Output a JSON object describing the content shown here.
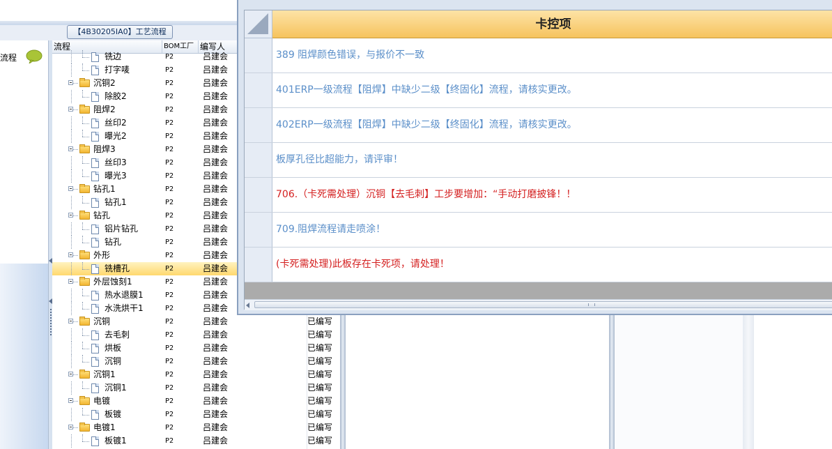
{
  "left_panel": {
    "title": "流程"
  },
  "process_tab": {
    "label": "【4B30205IA0】工艺流程"
  },
  "tree_headers": {
    "flow": "流程",
    "bom": "BOM工厂",
    "writer": "编写人"
  },
  "tree_rows": [
    {
      "name": "铣边",
      "level": 1,
      "bom": "P2",
      "writer": "吕建会"
    },
    {
      "name": "打字唛",
      "level": 1,
      "bom": "P2",
      "writer": "吕建会"
    },
    {
      "name": "沉铜2",
      "level": 0,
      "bom": "P2",
      "writer": "吕建会"
    },
    {
      "name": "除胶2",
      "level": 1,
      "bom": "P2",
      "writer": "吕建会"
    },
    {
      "name": "阻焊2",
      "level": 0,
      "bom": "P2",
      "writer": "吕建会"
    },
    {
      "name": "丝印2",
      "level": 1,
      "bom": "P2",
      "writer": "吕建会"
    },
    {
      "name": "曝光2",
      "level": 1,
      "bom": "P2",
      "writer": "吕建会"
    },
    {
      "name": "阻焊3",
      "level": 0,
      "bom": "P2",
      "writer": "吕建会"
    },
    {
      "name": "丝印3",
      "level": 1,
      "bom": "P2",
      "writer": "吕建会"
    },
    {
      "name": "曝光3",
      "level": 1,
      "bom": "P2",
      "writer": "吕建会"
    },
    {
      "name": "钻孔1",
      "level": 0,
      "bom": "P2",
      "writer": "吕建会"
    },
    {
      "name": "钻孔1",
      "level": 1,
      "bom": "P2",
      "writer": "吕建会"
    },
    {
      "name": "钻孔",
      "level": 0,
      "bom": "P2",
      "writer": "吕建会"
    },
    {
      "name": "铝片钻孔",
      "level": 1,
      "bom": "P2",
      "writer": "吕建会"
    },
    {
      "name": "钻孔",
      "level": 1,
      "bom": "P2",
      "writer": "吕建会"
    },
    {
      "name": "外形",
      "level": 0,
      "bom": "P2",
      "writer": "吕建会"
    },
    {
      "name": "铣槽孔",
      "level": 1,
      "bom": "P2",
      "writer": "吕建会",
      "selected": true
    },
    {
      "name": "外层蚀刻1",
      "level": 0,
      "bom": "P2",
      "writer": "吕建会"
    },
    {
      "name": "热水退膜1",
      "level": 1,
      "bom": "P2",
      "writer": "吕建会"
    },
    {
      "name": "水洗烘干1",
      "level": 1,
      "bom": "P2",
      "writer": "吕建会"
    },
    {
      "name": "沉铜",
      "level": 0,
      "bom": "P2",
      "writer": "吕建会"
    },
    {
      "name": "去毛刺",
      "level": 1,
      "bom": "P2",
      "writer": "吕建会"
    },
    {
      "name": "烘板",
      "level": 1,
      "bom": "P2",
      "writer": "吕建会"
    },
    {
      "name": "沉铜",
      "level": 1,
      "bom": "P2",
      "writer": "吕建会"
    },
    {
      "name": "沉铜1",
      "level": 0,
      "bom": "P2",
      "writer": "吕建会"
    },
    {
      "name": "沉铜1",
      "level": 1,
      "bom": "P2",
      "writer": "吕建会"
    },
    {
      "name": "电镀",
      "level": 0,
      "bom": "P2",
      "writer": "吕建会"
    },
    {
      "name": "板镀",
      "level": 1,
      "bom": "P2",
      "writer": "吕建会"
    },
    {
      "name": "电镀1",
      "level": 0,
      "bom": "P2",
      "writer": "吕建会"
    },
    {
      "name": "板镀1",
      "level": 1,
      "bom": "P2",
      "writer": "吕建会"
    }
  ],
  "status_values": [
    "已编写",
    "已编写",
    "已编写",
    "已编写",
    "已编写",
    "已编写",
    "已编写",
    "已编写",
    "已编写",
    "已编写"
  ],
  "dialog": {
    "header": "卡控项",
    "rows": [
      {
        "text": "389 阻焊颜色错误，与报价不一致",
        "color": "#5b8fc9"
      },
      {
        "text": "401ERP一级流程【阻焊】中缺少二级【终固化】流程，请核实更改。",
        "color": "#5b8fc9"
      },
      {
        "text": "402ERP一级流程【阻焊】中缺少二级【终固化】流程，请核实更改。",
        "color": "#5b8fc9"
      },
      {
        "text": "板厚孔径比超能力，请评审！",
        "color": "#5b8fc9"
      },
      {
        "text": "706.（卡死需处理）沉铜【去毛刺】工步要增加：“手动打磨披锋！！",
        "color": "#d42020"
      },
      {
        "text": "709.阻焊流程请走喷涂！",
        "color": "#5b8fc9"
      },
      {
        "text": "(卡死需处理)此板存在卡死项，请处理！",
        "color": "#d42020"
      }
    ]
  }
}
